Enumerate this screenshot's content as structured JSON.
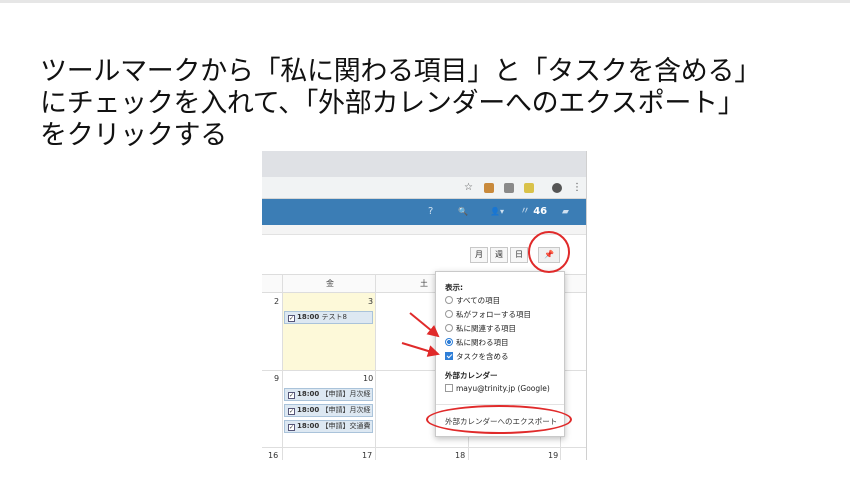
{
  "headline": {
    "line1": "ツールマークから「私に関わる項目」と「タスクを含める」",
    "line2": "にチェックを入れて、「外部カレンダーへのエクスポート」",
    "line3": "をクリックする"
  },
  "screenshot": {
    "browser": {
      "star_icon": "☆",
      "menu_icon": "⋮"
    },
    "appbar": {
      "help_icon": "?",
      "search_icon": "🔍",
      "user_icon": "👤▾",
      "feed_count": "46",
      "accent": "#3b7db5"
    },
    "view_buttons": [
      "月",
      "週",
      "日"
    ],
    "pin_icon": "📌",
    "weekdays": [
      "金",
      "土"
    ],
    "days": {
      "r1_left": "2",
      "r1_today": "3",
      "r2_left": "9",
      "r2_b": "10",
      "r3_a": "16",
      "r3_b": "17",
      "r3_c": "18",
      "r3_d": "19"
    },
    "events": {
      "e1_time": "18:00",
      "e1_title": "テスト8",
      "e2_time": "18:00",
      "e2_title": "【申請】月次経",
      "e3_time": "18:00",
      "e3_title": "【申請】月次経",
      "e4_time": "18:00",
      "e4_title": "【申請】交通費"
    },
    "panel": {
      "display_heading": "表示:",
      "options": [
        "すべての項目",
        "私がフォローする項目",
        "私に関連する項目",
        "私に関わる項目"
      ],
      "include_tasks": "タスクを含める",
      "external_heading": "外部カレンダー",
      "external_account": "mayu@trinity.jp (Google)",
      "export_label": "外部カレンダーへのエクスポート"
    },
    "highlight_color": "#e02a2a"
  }
}
